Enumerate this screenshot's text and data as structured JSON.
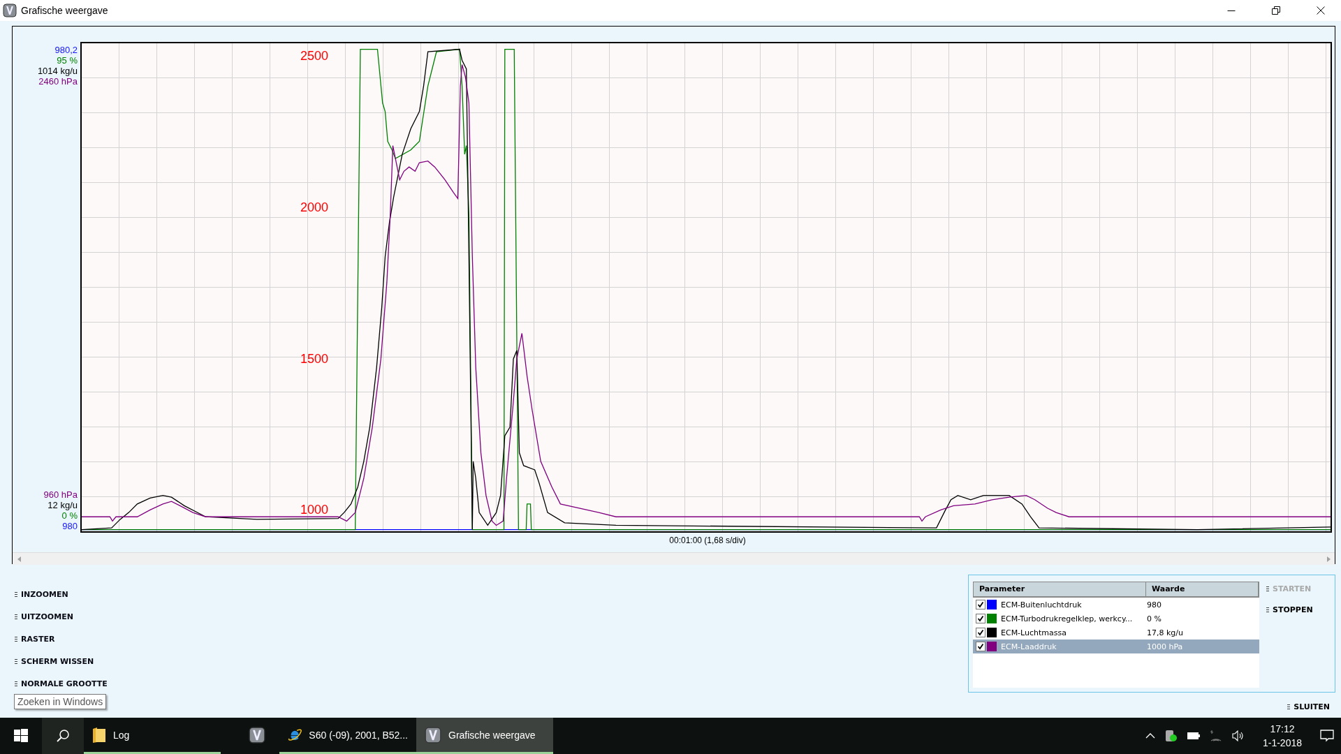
{
  "window": {
    "title": "Grafische weergave"
  },
  "graph": {
    "axis_labels_top": [
      {
        "text": "980,2",
        "color": "#1414ff"
      },
      {
        "text": "95 %",
        "color": "#008000"
      },
      {
        "text": "1014 kg/u",
        "color": "#000000"
      },
      {
        "text": "2460 hPa",
        "color": "#800080"
      }
    ],
    "axis_labels_bottom": [
      {
        "text": "960 hPa",
        "color": "#800080"
      },
      {
        "text": "12 kg/u",
        "color": "#000000"
      },
      {
        "text": "0 %",
        "color": "#008000"
      },
      {
        "text": "980",
        "color": "#1414ff"
      }
    ],
    "overlay_labels": [
      "2500",
      "2000",
      "1500",
      "1000"
    ],
    "time_label": "00:01:00 (1,68 s/div)"
  },
  "commands": [
    "INZOOMEN",
    "UITZOOMEN",
    "RASTER",
    "SCHERM WISSEN",
    "NORMALE GROOTTE"
  ],
  "tooltip": "Zoeken in Windows",
  "legend": {
    "columns": [
      "Parameter",
      "Waarde"
    ],
    "rows": [
      {
        "checked": true,
        "color": "#0000ff",
        "name": "ECM-Buitenluchtdruk",
        "value": "980",
        "selected": false
      },
      {
        "checked": true,
        "color": "#008000",
        "name": "ECM-Turbodrukregelklep, werkcy...",
        "value": "0 %",
        "selected": false
      },
      {
        "checked": true,
        "color": "#000000",
        "name": "ECM-Luchtmassa",
        "value": "17,8 kg/u",
        "selected": false
      },
      {
        "checked": true,
        "color": "#800080",
        "name": "ECM-Laaddruk",
        "value": "1000 hPa",
        "selected": true
      }
    ]
  },
  "side_buttons": [
    {
      "label": "STARTEN",
      "disabled": true
    },
    {
      "label": "STOPPEN",
      "disabled": false
    }
  ],
  "close_button": "SLUITEN",
  "taskbar": {
    "items": [
      {
        "kind": "folder",
        "label": "Log",
        "running": true,
        "selected": false
      },
      {
        "kind": "app",
        "running": false,
        "selected": false
      },
      {
        "kind": "browser",
        "label": "S60 (-09), 2001, B52...",
        "running": true,
        "selected": false
      },
      {
        "kind": "app",
        "label": "Grafische weergave",
        "running": true,
        "selected": true
      }
    ],
    "time": "17:12",
    "date": "1-1-2018"
  }
}
